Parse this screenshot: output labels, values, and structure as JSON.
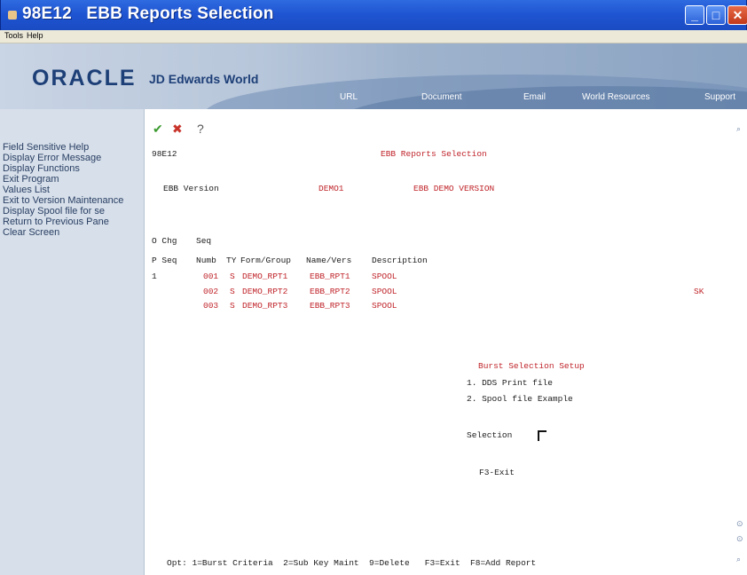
{
  "window": {
    "title": "98E12   EBB Reports Selection",
    "min_glyph": "_",
    "max_glyph": "□",
    "close_glyph": "✕"
  },
  "menu": {
    "tools": "Tools",
    "help": "Help"
  },
  "banner": {
    "oracle": "ORACLE",
    "jde": "JD Edwards World",
    "links": [
      "URL",
      "Document",
      "Email",
      "World Resources",
      "Support"
    ]
  },
  "left_menu": [
    "Field Sensitive Help",
    "Display Error Message",
    "Display Functions",
    "Exit Program",
    "Values List",
    "Exit to Version Maintenance",
    "Display Spool file for se",
    "Return to Previous Pane",
    "Clear Screen"
  ],
  "toolbar": {
    "ok_glyph": "✔",
    "cancel_glyph": "✖",
    "help_glyph": "?"
  },
  "form": {
    "program_id": "98E12",
    "title": "EBB Reports Selection",
    "version_label": "EBB Version",
    "version_value": "DEMO1",
    "version_desc": "EBB DEMO VERSION",
    "headers_line1": [
      "O Chg",
      "Seq"
    ],
    "headers_line2": [
      "P Seq",
      "Numb",
      "TY",
      "Form/Group",
      "Name/Vers",
      "Description"
    ],
    "rows": [
      {
        "op": "",
        "chg_seq": "1",
        "seq": "001",
        "ty": "S",
        "form": "DEMO_RPT1",
        "name": "EBB_RPT1",
        "desc": "SPOOL",
        "flag": ""
      },
      {
        "op": "",
        "chg_seq": "",
        "seq": "002",
        "ty": "S",
        "form": "DEMO_RPT2",
        "name": "EBB_RPT2",
        "desc": "SPOOL",
        "flag": "SK"
      },
      {
        "op": "",
        "chg_seq": "",
        "seq": "003",
        "ty": "S",
        "form": "DEMO_RPT3",
        "name": "EBB_RPT3",
        "desc": "SPOOL",
        "flag": ""
      }
    ],
    "burst": {
      "title": "Burst Selection Setup",
      "option1": "1. DDS Print file",
      "option2": "2. Spool file Example",
      "selection_label": "Selection",
      "exit": "F3-Exit"
    },
    "footer": "Opt: 1=Burst Criteria  2=Sub Key Maint  9=Delete   F3=Exit  F8=Add Report"
  }
}
